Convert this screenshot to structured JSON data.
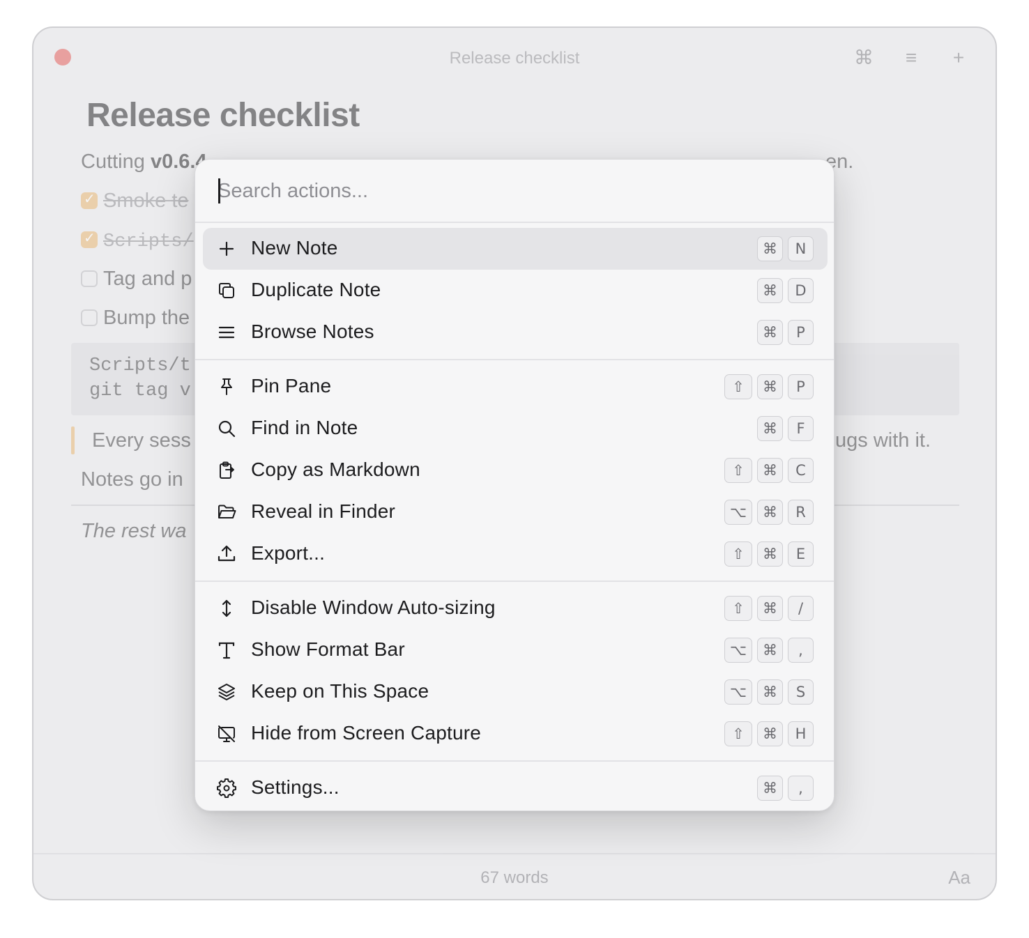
{
  "window": {
    "title": "Release checklist",
    "toolbar": {
      "command_icon": "⌘",
      "menu_icon": "≡",
      "add_icon": "+"
    }
  },
  "note": {
    "heading": "Release checklist",
    "intro_prefix": "Cutting ",
    "intro_version": "v0.6.4",
    "intro_visible_tail": "en.",
    "checklist": [
      {
        "text": "Smoke te",
        "checked": true,
        "mono": false
      },
      {
        "text": "Scripts/",
        "checked": true,
        "mono": true
      },
      {
        "text": "Tag and p",
        "checked": false,
        "mono": false
      },
      {
        "text": "Bump the",
        "checked": false,
        "mono": false
      }
    ],
    "code_lines": [
      "Scripts/t",
      "git tag v"
    ],
    "quote_visible_start": "Every sess",
    "quote_visible_end": "ugs with it.",
    "paragraph": "Notes go in",
    "italic": "The rest wa"
  },
  "footer": {
    "word_count": "67 words",
    "font_button": "Aa"
  },
  "palette": {
    "search_placeholder": "Search actions...",
    "items": [
      {
        "label": "New Note",
        "icon": "plus-icon",
        "keys": [
          "⌘",
          "N"
        ],
        "selected": true
      },
      {
        "label": "Duplicate Note",
        "icon": "duplicate-icon",
        "keys": [
          "⌘",
          "D"
        ]
      },
      {
        "label": "Browse Notes",
        "icon": "list-icon",
        "keys": [
          "⌘",
          "P"
        ]
      },
      {
        "label": "Pin Pane",
        "icon": "pin-icon",
        "keys": [
          "⇧",
          "⌘",
          "P"
        ]
      },
      {
        "label": "Find in Note",
        "icon": "search-icon",
        "keys": [
          "⌘",
          "F"
        ]
      },
      {
        "label": "Copy as Markdown",
        "icon": "clipboard-icon",
        "keys": [
          "⇧",
          "⌘",
          "C"
        ]
      },
      {
        "label": "Reveal in Finder",
        "icon": "folder-icon",
        "keys": [
          "⌥",
          "⌘",
          "R"
        ]
      },
      {
        "label": "Export...",
        "icon": "export-icon",
        "keys": [
          "⇧",
          "⌘",
          "E"
        ]
      },
      {
        "label": "Disable Window Auto-sizing",
        "icon": "resize-vertical-icon",
        "keys": [
          "⇧",
          "⌘",
          "/"
        ]
      },
      {
        "label": "Show Format Bar",
        "icon": "text-format-icon",
        "keys": [
          "⌥",
          "⌘",
          ","
        ]
      },
      {
        "label": "Keep on This Space",
        "icon": "layers-icon",
        "keys": [
          "⌥",
          "⌘",
          "S"
        ]
      },
      {
        "label": "Hide from Screen Capture",
        "icon": "screen-off-icon",
        "keys": [
          "⇧",
          "⌘",
          "H"
        ]
      },
      {
        "label": "Settings...",
        "icon": "gear-icon",
        "keys": [
          "⌘",
          ","
        ]
      }
    ]
  }
}
